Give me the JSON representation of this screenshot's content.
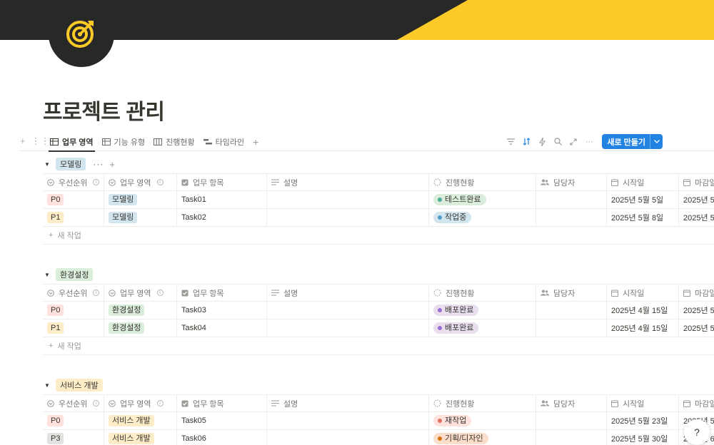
{
  "page": {
    "title": "프로젝트 관리"
  },
  "colors": {
    "cover_dark": "#282826",
    "cover_yellow": "#fdca28",
    "accent": "#2383e2"
  },
  "views": {
    "tabs": [
      {
        "label": "업무 영역",
        "icon": "table-icon",
        "active": true
      },
      {
        "label": "기능 유형",
        "icon": "table-icon",
        "active": false
      },
      {
        "label": "진행현황",
        "icon": "board-icon",
        "active": false
      },
      {
        "label": "타임라인",
        "icon": "timeline-icon",
        "active": false
      }
    ],
    "add_label": "+"
  },
  "toolbar": {
    "new_button_label": "새로 만들기"
  },
  "columns": [
    "우선순위",
    "업무 영역",
    "업무 항목",
    "설명",
    "진행현황",
    "담당자",
    "시작일",
    "마감일"
  ],
  "add_row_label": "새 작업",
  "groups": [
    {
      "name": "모델링",
      "rows": [
        {
          "priority": "P0",
          "area": "모델링",
          "task": "Task01",
          "status": "테스트완료",
          "start": "2025년 5월 5일",
          "due": "2025년 5"
        },
        {
          "priority": "P1",
          "area": "모델링",
          "task": "Task02",
          "status": "작업중",
          "start": "2025년 5월 8일",
          "due": "2025년 5"
        }
      ]
    },
    {
      "name": "환경설정",
      "rows": [
        {
          "priority": "P0",
          "area": "환경설정",
          "task": "Task03",
          "status": "배포완료",
          "start": "2025년 4월 15일",
          "due": "2025년 5"
        },
        {
          "priority": "P1",
          "area": "환경설정",
          "task": "Task04",
          "status": "배포완료",
          "start": "2025년 4월 15일",
          "due": "2025년 5"
        }
      ]
    },
    {
      "name": "서비스 개발",
      "rows": [
        {
          "priority": "P0",
          "area": "서비스 개발",
          "task": "Task05",
          "status": "재작업",
          "start": "2025년 5월 23일",
          "due": "2025년 5"
        },
        {
          "priority": "P3",
          "area": "서비스 개발",
          "task": "Task06",
          "status": "기획/디자인",
          "start": "2025년 5월 30일",
          "due": "2025년 6"
        }
      ]
    }
  ]
}
